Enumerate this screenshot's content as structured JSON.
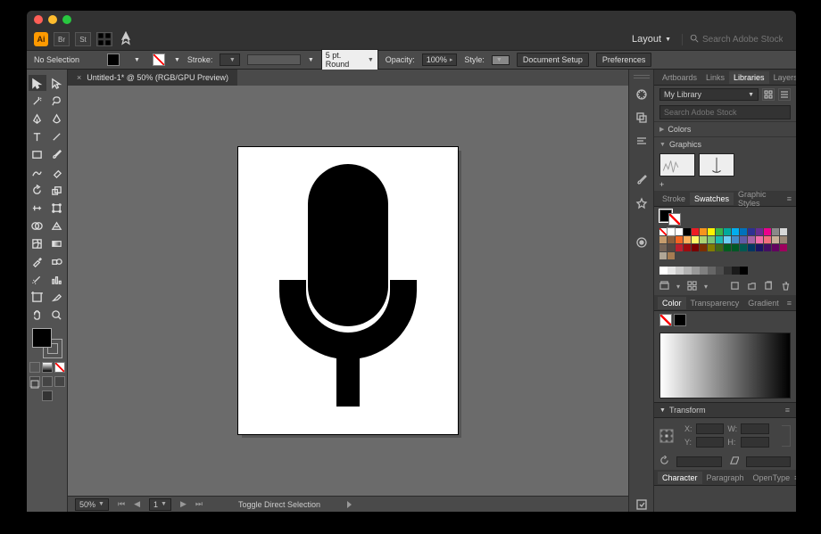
{
  "menubar": {
    "br_label": "Br",
    "st_label": "St",
    "layout_label": "Layout",
    "search_placeholder": "Search Adobe Stock"
  },
  "ctrlbar": {
    "selection": "No Selection",
    "stroke_label": "Stroke:",
    "stroke_pt": "5 pt. Round",
    "opacity_label": "Opacity:",
    "opacity_val": "100%",
    "style_label": "Style:",
    "doc_setup": "Document Setup",
    "prefs": "Preferences"
  },
  "doc": {
    "tab_title": "Untitled-1* @ 50% (RGB/GPU Preview)"
  },
  "status": {
    "zoom": "50%",
    "page": "1",
    "tool": "Toggle Direct Selection"
  },
  "panels": {
    "top_tabs": [
      "Artboards",
      "Links",
      "Libraries",
      "Layers"
    ],
    "top_active": 2,
    "library_name": "My Library",
    "lib_search_placeholder": "Search Adobe Stock",
    "colors_label": "Colors",
    "graphics_label": "Graphics",
    "sw_tabs": [
      "Stroke",
      "Swatches",
      "Graphic Styles"
    ],
    "sw_active": 1,
    "color_tabs": [
      "Color",
      "Transparency",
      "Gradient"
    ],
    "color_active": 0,
    "transform_label": "Transform",
    "x_label": "X:",
    "y_label": "Y:",
    "w_label": "W:",
    "h_label": "H:",
    "type_tabs": [
      "Character",
      "Paragraph",
      "OpenType"
    ],
    "type_active": 0
  },
  "swatches": [
    "#ffffff",
    "#000000",
    "#ed1c24",
    "#f7941d",
    "#fff200",
    "#39b54a",
    "#00a99d",
    "#00aeef",
    "#0072bc",
    "#2e3192",
    "#662d91",
    "#ec008c",
    "#898989",
    "#d7d7d7",
    "#c69c6d",
    "#8b5e3c",
    "#f26522",
    "#fbaf5d",
    "#fff568",
    "#acd373",
    "#7cc576",
    "#1cbbb4",
    "#6dcff6",
    "#438ccb",
    "#605ca8",
    "#a864a8",
    "#f06eaa",
    "#f26d7d",
    "#c7b299",
    "#998675",
    "#736357",
    "#534741",
    "#be1e2d",
    "#9e0b0f",
    "#790000",
    "#7b2e00",
    "#827b00",
    "#406618",
    "#005e20",
    "#005826",
    "#005952",
    "#003663",
    "#1b1464",
    "#440e62",
    "#630460",
    "#9e005d",
    "#b0a696",
    "#a67c52"
  ],
  "grays": [
    "#ffffff",
    "#e6e6e6",
    "#cccccc",
    "#b3b3b3",
    "#999999",
    "#808080",
    "#666666",
    "#4d4d4d",
    "#333333",
    "#1a1a1a",
    "#000000"
  ]
}
